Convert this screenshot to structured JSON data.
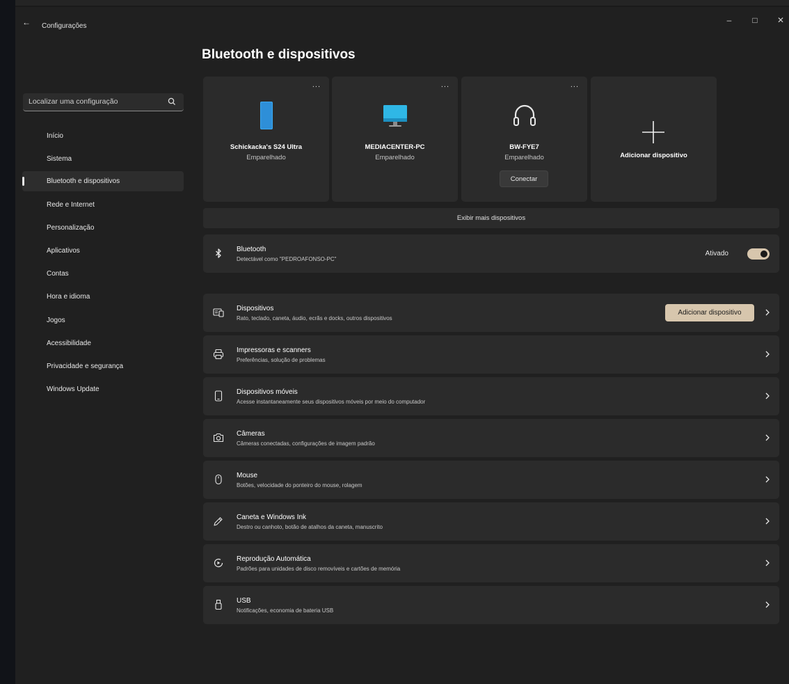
{
  "window": {
    "app_title": "Configurações",
    "back_glyph": "←",
    "minimize_glyph": "–",
    "maximize_glyph": "□",
    "close_glyph": "✕"
  },
  "sidebar": {
    "search_placeholder": "Localizar uma configuração",
    "items": [
      {
        "label": "Início",
        "active": false
      },
      {
        "label": "Sistema",
        "active": false
      },
      {
        "label": "Bluetooth e dispositivos",
        "active": true
      },
      {
        "label": "Rede e Internet",
        "active": false
      },
      {
        "label": "Personalização",
        "active": false
      },
      {
        "label": "Aplicativos",
        "active": false
      },
      {
        "label": "Contas",
        "active": false
      },
      {
        "label": "Hora e idioma",
        "active": false
      },
      {
        "label": "Jogos",
        "active": false
      },
      {
        "label": "Acessibilidade",
        "active": false
      },
      {
        "label": "Privacidade e segurança",
        "active": false
      },
      {
        "label": "Windows Update",
        "active": false
      }
    ]
  },
  "page": {
    "title": "Bluetooth e dispositivos"
  },
  "devices": [
    {
      "name": "Schickacka's S24 Ultra",
      "status": "Emparelhado",
      "icon": "phone-icon",
      "more": "..."
    },
    {
      "name": "MEDIACENTER-PC",
      "status": "Emparelhado",
      "icon": "monitor-icon",
      "more": "..."
    },
    {
      "name": "BW-FYE7",
      "status": "Emparelhado",
      "icon": "headphones-icon",
      "more": "...",
      "connect_label": "Conectar"
    }
  ],
  "add_device_card": {
    "label": "Adicionar dispositivo",
    "icon": "plus-icon"
  },
  "more_devices_label": "Exibir mais dispositivos",
  "bluetooth": {
    "title": "Bluetooth",
    "desc": "Detectável como \"PEDROAFONSO-PC\"",
    "state_label": "Ativado",
    "on": true,
    "icon": "bluetooth-icon"
  },
  "rows": [
    {
      "title": "Dispositivos",
      "desc": "Rato, teclado, caneta, áudio, ecrãs e docks, outros dispositivos",
      "icon": "devices-icon",
      "button_label": "Adicionar dispositivo"
    },
    {
      "title": "Impressoras e scanners",
      "desc": "Preferências, solução de problemas",
      "icon": "printer-icon"
    },
    {
      "title": "Dispositivos móveis",
      "desc": "Acesse instantaneamente seus dispositivos móveis por meio do computador",
      "icon": "mobile-icon"
    },
    {
      "title": "Câmeras",
      "desc": "Câmeras conectadas, configurações de imagem padrão",
      "icon": "camera-icon"
    },
    {
      "title": "Mouse",
      "desc": "Botões, velocidade do ponteiro do mouse, rolagem",
      "icon": "mouse-icon"
    },
    {
      "title": "Caneta e Windows Ink",
      "desc": "Destro ou canhoto, botão de atalhos da caneta, manuscrito",
      "icon": "pen-icon"
    },
    {
      "title": "Reprodução Automática",
      "desc": "Padrões para unidades de disco removíveis e cartões de memória",
      "icon": "autoplay-icon"
    },
    {
      "title": "USB",
      "desc": "Notificações, economia de bateria USB",
      "icon": "usb-icon"
    }
  ],
  "colors": {
    "accent": "#d7c6ad",
    "background": "#202020",
    "card": "#2b2b2b",
    "phone_blue": "#3aa8f0",
    "monitor_blue": "#2fb7e6"
  }
}
